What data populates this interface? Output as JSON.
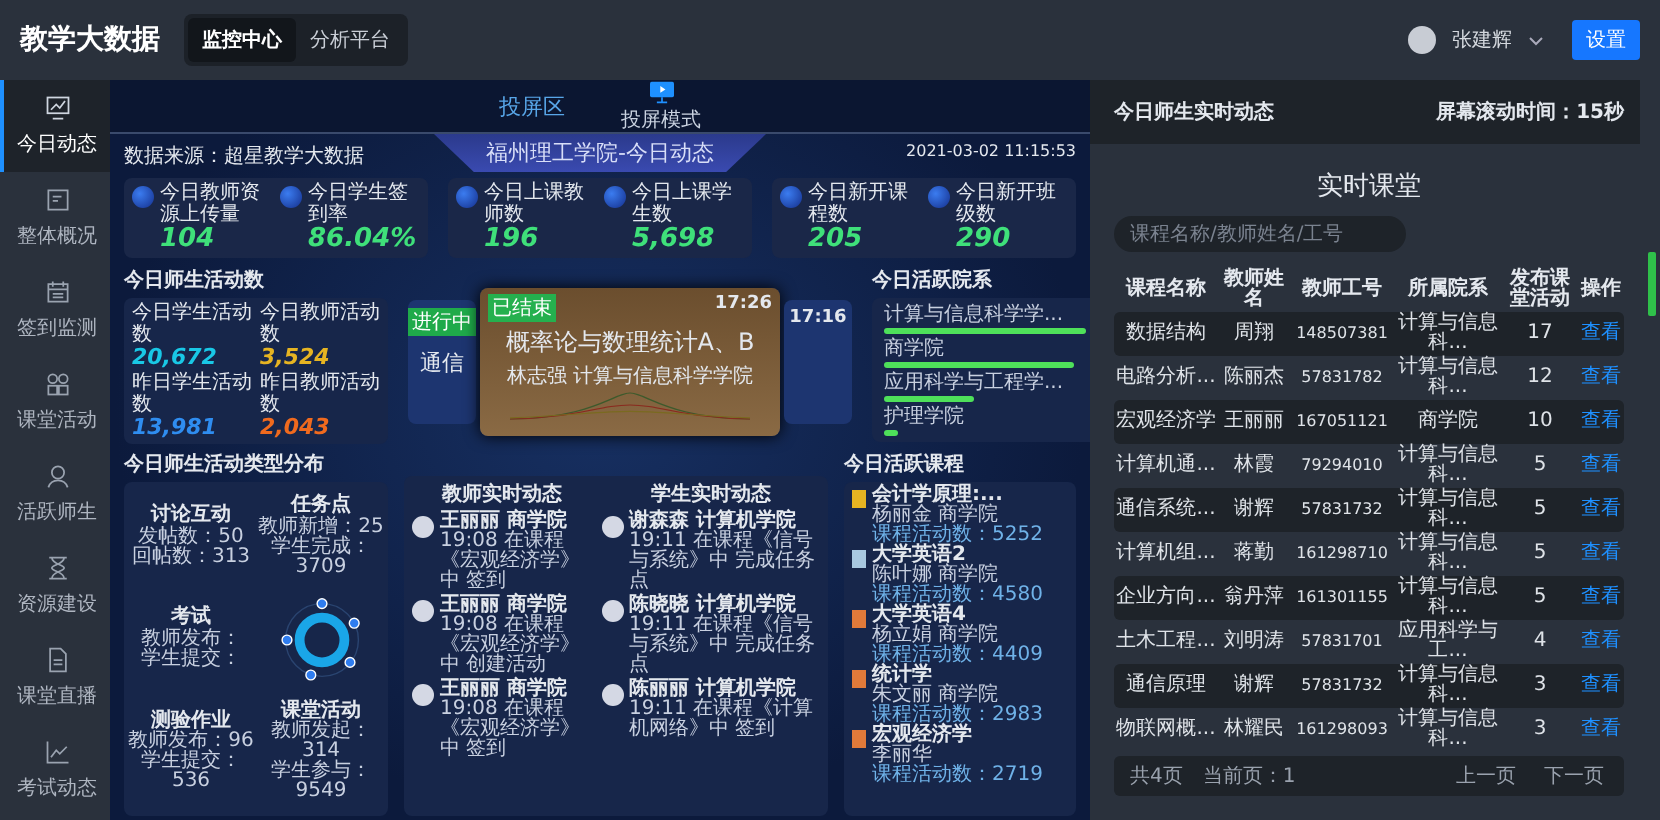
{
  "header": {
    "logo": "教学大数据",
    "tabs": [
      {
        "label": "监控中心",
        "selected": true
      },
      {
        "label": "分析平台",
        "selected": false
      }
    ],
    "user": "张建辉",
    "settings_button": "设置"
  },
  "sidebar": {
    "items": [
      {
        "label": "今日动态",
        "selected": true,
        "kind": "chart"
      },
      {
        "label": "整体概况",
        "selected": false,
        "kind": "doc"
      },
      {
        "label": "签到监测",
        "selected": false,
        "kind": "calendar"
      },
      {
        "label": "课堂活动",
        "selected": false,
        "kind": "grid"
      },
      {
        "label": "活跃师生",
        "selected": false,
        "kind": "user"
      },
      {
        "label": "资源建设",
        "selected": false,
        "kind": "hourglass"
      },
      {
        "label": "课堂直播",
        "selected": false,
        "kind": "file"
      },
      {
        "label": "考试动态",
        "selected": false,
        "kind": "line"
      }
    ]
  },
  "projection": {
    "label": "投屏区",
    "mode_label": "投屏模式"
  },
  "dashboard": {
    "title": "福州理工学院-今日动态",
    "source": "数据来源：超星教学大数据",
    "datetime": "2021-03-02 11:15:53",
    "stat_groups": [
      [
        {
          "label": "今日教师资源上传量",
          "value": "104"
        },
        {
          "label": "今日学生签到率",
          "value": "86.04%"
        }
      ],
      [
        {
          "label": "今日上课教师数",
          "value": "196"
        },
        {
          "label": "今日上课学生数",
          "value": "5,698"
        }
      ],
      [
        {
          "label": "今日新开课程数",
          "value": "205"
        },
        {
          "label": "今日新开班级数",
          "value": "290"
        }
      ]
    ],
    "activity": {
      "title": "今日师生活动数",
      "items": [
        {
          "label": "今日学生活动数",
          "value": "20,672",
          "color": "#19c8e6"
        },
        {
          "label": "今日教师活动数",
          "value": "3,524",
          "color": "#e6b422"
        },
        {
          "label": "昨日学生活动数",
          "value": "13,981",
          "color": "#2f8df0"
        },
        {
          "label": "昨日教师活动数",
          "value": "2,043",
          "color": "#f06a1e"
        }
      ]
    },
    "carousel": {
      "left": {
        "status": "进行中",
        "title": "通信"
      },
      "center": {
        "status": "已结束",
        "time": "17:26",
        "title": "概率论与数理统计A、B",
        "subtitle": "林志强  计算与信息科学学院"
      },
      "right": {
        "time": "17:16"
      }
    },
    "departments": {
      "title": "今日活跃院系",
      "items": [
        {
          "label": "计算与信息科学学...",
          "level": 0.9
        },
        {
          "label": "商学院",
          "level": 0.85
        },
        {
          "label": "应用科学与工程学...",
          "level": 0.4
        },
        {
          "label": "护理学院",
          "level": 0.06
        }
      ]
    },
    "activity_types": {
      "title": "今日师生活动类型分布",
      "items": [
        {
          "title": "讨论互动",
          "lines": [
            "发帖数：50",
            "回帖数：313"
          ]
        },
        {
          "title": "任务点",
          "lines": [
            "教师新增：25",
            "学生完成：3709"
          ]
        },
        {
          "title": "考试",
          "lines": [
            "教师发布：",
            "学生提交："
          ]
        },
        {
          "title": "测验作业",
          "lines": [
            "教师发布：96",
            "学生提交：536"
          ]
        },
        {
          "title": "课堂活动",
          "lines": [
            "教师发起：314",
            "学生参与：9549"
          ]
        }
      ]
    },
    "feeds": [
      {
        "title": "教师实时动态",
        "items": [
          {
            "name": "王丽丽",
            "dept": "商学院",
            "text": "19:08 在课程《宏观经济学》中 签到"
          },
          {
            "name": "王丽丽",
            "dept": "商学院",
            "text": "19:08 在课程《宏观经济学》中 创建活动"
          },
          {
            "name": "王丽丽",
            "dept": "商学院",
            "text": "19:08 在课程《宏观经济学》中 签到"
          }
        ]
      },
      {
        "title": "学生实时动态",
        "items": [
          {
            "name": "谢森森",
            "dept": "计算机学院",
            "text": "19:11 在课程《信号与系统》中 完成任务点"
          },
          {
            "name": "陈晓晓",
            "dept": "计算机学院",
            "text": "19:11 在课程《信号与系统》中 完成任务点"
          },
          {
            "name": "陈丽丽",
            "dept": "计算机学院",
            "text": "19:11 在课程《计算机网络》中 签到"
          }
        ]
      }
    ],
    "courses": {
      "title": "今日活跃课程",
      "items": [
        {
          "name": "会计学原理:...",
          "teacher": "杨丽金  商学院",
          "count": "课程活动数：5252",
          "color": "#e6b422"
        },
        {
          "name": "大学英语2",
          "teacher": "陈叶娜  商学院",
          "count": "课程活动数：4580",
          "color": "#a8c8e0"
        },
        {
          "name": "大学英语4",
          "teacher": "杨立娟  商学院",
          "count": "课程活动数：4409",
          "color": "#e07a3a"
        },
        {
          "name": "统计学",
          "teacher": "朱文丽  商学院",
          "count": "课程活动数：2983",
          "color": "#e07a3a"
        },
        {
          "name": "宏观经济学",
          "teacher": "李丽华",
          "count": "课程活动数：2719",
          "color": "#e07a3a"
        }
      ]
    }
  },
  "right_panel": {
    "title": "今日师生实时动态",
    "scroll_time": "屏幕滚动时间：15秒",
    "heading": "实时课堂",
    "search": {
      "placeholder": "课程名称/教师姓名/工号"
    },
    "table": {
      "columns": [
        "课程名称",
        "教师姓名",
        "教师工号",
        "所属院系",
        "发布课堂活动",
        "操作"
      ],
      "rows": [
        [
          "数据结构",
          "周翔",
          "148507381",
          "计算与信息科...",
          "17",
          "查看"
        ],
        [
          "电路分析...",
          "陈丽杰",
          "57831782",
          "计算与信息科...",
          "12",
          "查看"
        ],
        [
          "宏观经济学",
          "王丽丽",
          "167051121",
          "商学院",
          "10",
          "查看"
        ],
        [
          "计算机通...",
          "林霞",
          "79294010",
          "计算与信息科...",
          "5",
          "查看"
        ],
        [
          "通信系统...",
          "谢辉",
          "57831732",
          "计算与信息科...",
          "5",
          "查看"
        ],
        [
          "计算机组...",
          "蒋勤",
          "161298710",
          "计算与信息科...",
          "5",
          "查看"
        ],
        [
          "企业方向...",
          "翁丹萍",
          "161301155",
          "计算与信息科...",
          "5",
          "查看"
        ],
        [
          "土木工程...",
          "刘明涛",
          "57831701",
          "应用科学与工...",
          "4",
          "查看"
        ],
        [
          "通信原理",
          "谢辉",
          "57831732",
          "计算与信息科...",
          "3",
          "查看"
        ],
        [
          "物联网概...",
          "林耀民",
          "161298093",
          "计算与信息科...",
          "3",
          "查看"
        ]
      ]
    },
    "pager": {
      "total": "共4页",
      "current": "当前页：1",
      "prev": "上一页",
      "next": "下一页"
    }
  }
}
